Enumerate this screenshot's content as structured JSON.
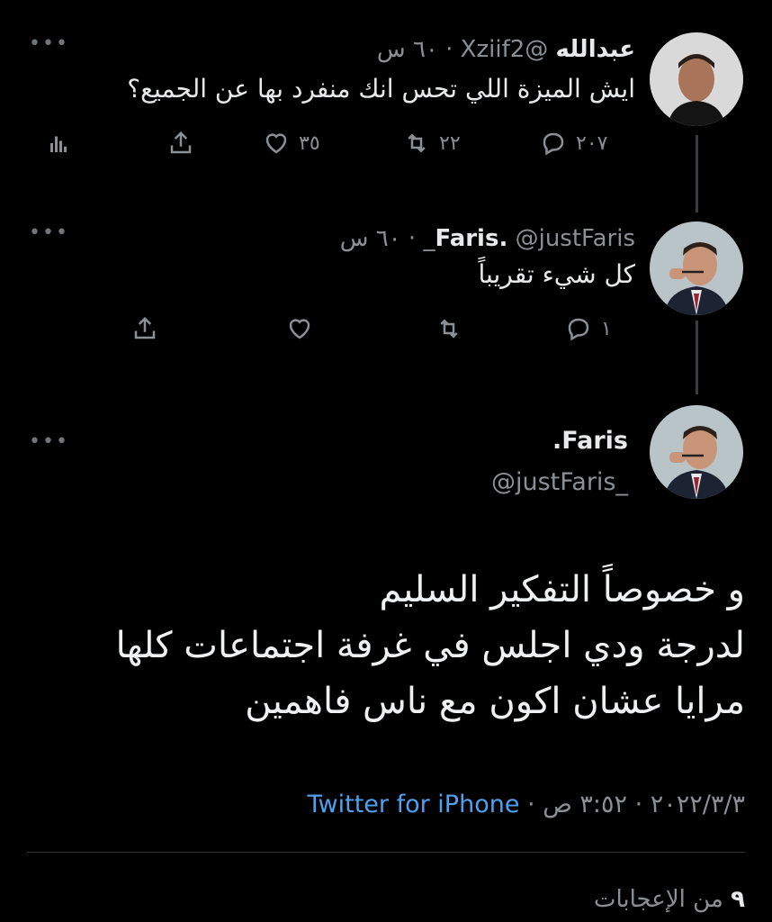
{
  "tweets": [
    {
      "name": "عبدالله",
      "handle": "@Xziif2",
      "time": "٦٠ س",
      "text": "ايش الميزة اللي تحس انك منفرد بها عن الجميع؟",
      "replies": "٢٠٧",
      "retweets": "٢٢",
      "likes": "٣٥"
    },
    {
      "name": "Faris.",
      "handle": "@justFaris_",
      "time": "٦٠ س",
      "text": "كل شيء تقريباً",
      "replies": "١"
    }
  ],
  "main_tweet": {
    "name": "Faris.",
    "handle": "@justFaris_",
    "lines": [
      "و خصوصاً التفكير السليم",
      "لدرجة ودي اجلس في غرفة اجتماعات كلها",
      "مرايا عشان اكون مع ناس فاهمين"
    ],
    "date": "٢٠٢٢/٣/٣",
    "time": "٣:٥٢ ص",
    "source": "Twitter for iPhone",
    "likes_count": "٩",
    "likes_label": "من الإعجابات"
  },
  "more_glyph": "•••",
  "separator": " · ",
  "icons": [
    "reply-icon",
    "retweet-icon",
    "like-icon",
    "share-icon",
    "analytics-icon",
    "more-icon"
  ],
  "colors": {
    "background": "#000000",
    "link": "#4ea1f0",
    "muted": "#8b9095"
  }
}
